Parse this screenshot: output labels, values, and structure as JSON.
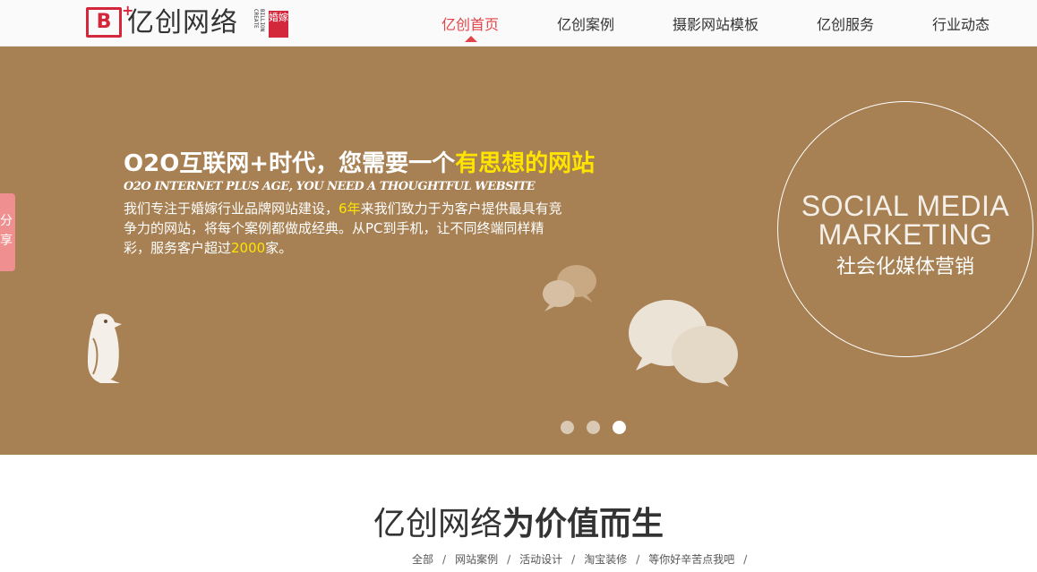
{
  "logo": {
    "badge": "B",
    "name": "亿创网络",
    "name_en": "BILLION CREATE",
    "seal": "婚嫁",
    "brand_color": "#d3273b"
  },
  "nav": {
    "items": [
      "亿创首页",
      "亿创案例",
      "摄影网站模板",
      "亿创服务",
      "行业动态"
    ],
    "active_index": 0,
    "active_color": "#e0454a"
  },
  "share": {
    "label": "分享"
  },
  "banner": {
    "background": "#a78053",
    "headline_pre": "O2O互联网+时代，您需要一个",
    "headline_highlight": "有思想的网站",
    "subheadline": "O2O INTERNET PLUS AGE, YOU NEED A THOUGHTFUL WEBSITE",
    "desc_part1": "我们专注于婚嫁行业品牌网站建设，",
    "desc_years": "6年",
    "desc_part2": "来我们致力于为客户提供最具有竞争力的网站，将每个案例都做成经典。从PC到手机，让不同终端同样精彩，服务客户超过",
    "desc_count": "2000",
    "desc_part3": "家。",
    "highlight_color": "#ffe400",
    "circle_line1": "SOCIAL MEDIA",
    "circle_line2": "MARKETING",
    "circle_cn": "社会化媒体营销",
    "slides_total": 3,
    "slide_active": 3
  },
  "intro": {
    "title_light": "亿创网络",
    "title_bold": "为价值而生",
    "filters": [
      "全部",
      "网站案例",
      "活动设计",
      "淘宝装修",
      "等你好辛苦点我吧"
    ],
    "separator": "/"
  },
  "icons": [
    "penguin-icon",
    "speech-bubbles-icon"
  ]
}
